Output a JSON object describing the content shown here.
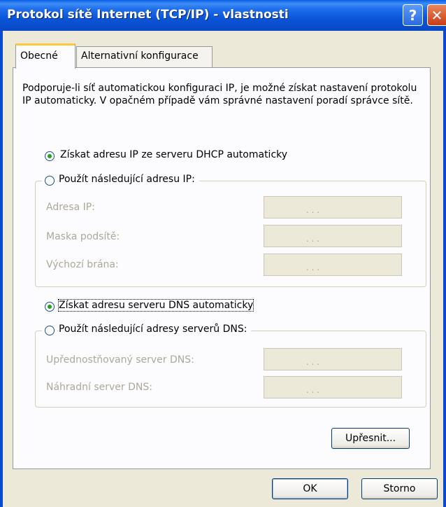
{
  "window": {
    "title": "Protokol sítě Internet (TCP/IP) - vlastnosti",
    "help_label": "?",
    "close_label": "✕"
  },
  "tabs": [
    {
      "label": "Obecné"
    },
    {
      "label": "Alternativní konfigurace"
    }
  ],
  "description": "Podporuje-li síť automatickou konfiguraci IP, je možné získat nastavení protokolu IP automaticky. V opačném případě vám správné nastavení poradí správce sítě.",
  "ip": {
    "auto_label": "Získat adresu IP ze serveru DHCP automaticky",
    "manual_label": "Použít následující adresu IP:",
    "selected": "auto",
    "fields": [
      {
        "label": "Adresa IP:",
        "value": ".   .   ."
      },
      {
        "label": "Maska podsítě:",
        "value": ".   .   ."
      },
      {
        "label": "Výchozí brána:",
        "value": ".   .   ."
      }
    ]
  },
  "dns": {
    "auto_label": "Získat adresu serveru DNS automaticky",
    "manual_label": "Použít následující adresy serverů DNS:",
    "selected": "auto",
    "fields": [
      {
        "label": "Upřednostňovaný server DNS:",
        "value": ".   .   ."
      },
      {
        "label": "Náhradní server DNS:",
        "value": ".   .   ."
      }
    ]
  },
  "buttons": {
    "advanced": "Upřesnit...",
    "ok": "OK",
    "cancel": "Storno"
  }
}
